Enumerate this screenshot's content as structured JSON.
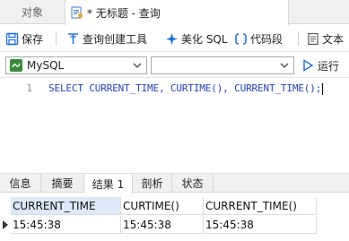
{
  "tabs": {
    "objects_label": "对象",
    "query_label": "* 无标题 - 查询"
  },
  "toolbar": {
    "save_label": "保存",
    "query_builder_label": "查询创建工具",
    "beautify_label": "美化 SQL",
    "snippet_label": "代码段",
    "text_label": "文本"
  },
  "connection": {
    "selected": "MySQL",
    "database_selected": "",
    "run_label": "运行"
  },
  "editor": {
    "line_number": "1",
    "code": "SELECT CURRENT_TIME, CURTIME(), CURRENT_TIME();"
  },
  "result_tabs": [
    "信息",
    "摘要",
    "结果 1",
    "剖析",
    "状态"
  ],
  "result_active_tab": "结果 1",
  "grid": {
    "columns": [
      "CURRENT_TIME",
      "CURTIME()",
      "CURRENT_TIME()"
    ],
    "rows": [
      [
        "15:45:38",
        "15:45:38",
        "15:45:38"
      ]
    ]
  },
  "colors": {
    "keyword": "#2442b8",
    "accent": "#1e6fd9",
    "selected_header": "#dce9f8"
  }
}
